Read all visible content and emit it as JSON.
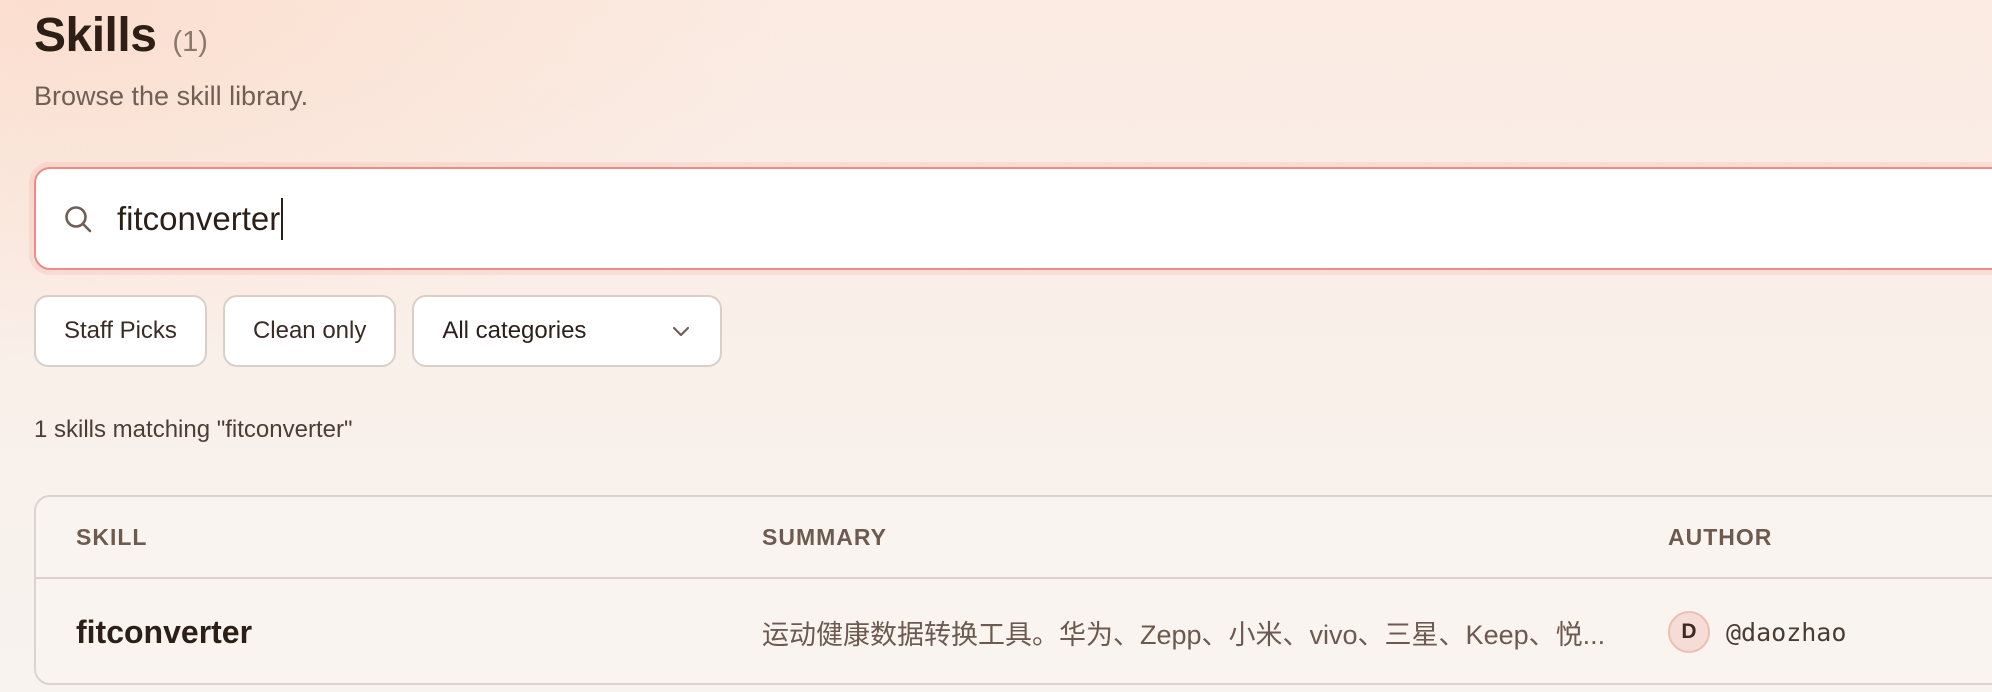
{
  "header": {
    "title": "Skills",
    "count": "(1)",
    "subtitle": "Browse the skill library."
  },
  "search": {
    "value": "fitconverter",
    "icon": "search-icon"
  },
  "filters": {
    "staff_picks": "Staff Picks",
    "clean_only": "Clean only",
    "category_selected": "All categories",
    "category_icon": "chevron-down-icon"
  },
  "results": {
    "summary": "1 skills matching \"fitconverter\""
  },
  "table": {
    "columns": [
      "SKILL",
      "SUMMARY",
      "AUTHOR"
    ],
    "rows": [
      {
        "skill": "fitconverter",
        "summary": "运动健康数据转换工具。华为、Zepp、小米、vivo、三星、Keep、悦...",
        "author_initial": "D",
        "author_handle": "@daozhao"
      }
    ]
  },
  "colors": {
    "accent_border": "#eb8c86",
    "avatar_bg": "#f7dcd5"
  }
}
